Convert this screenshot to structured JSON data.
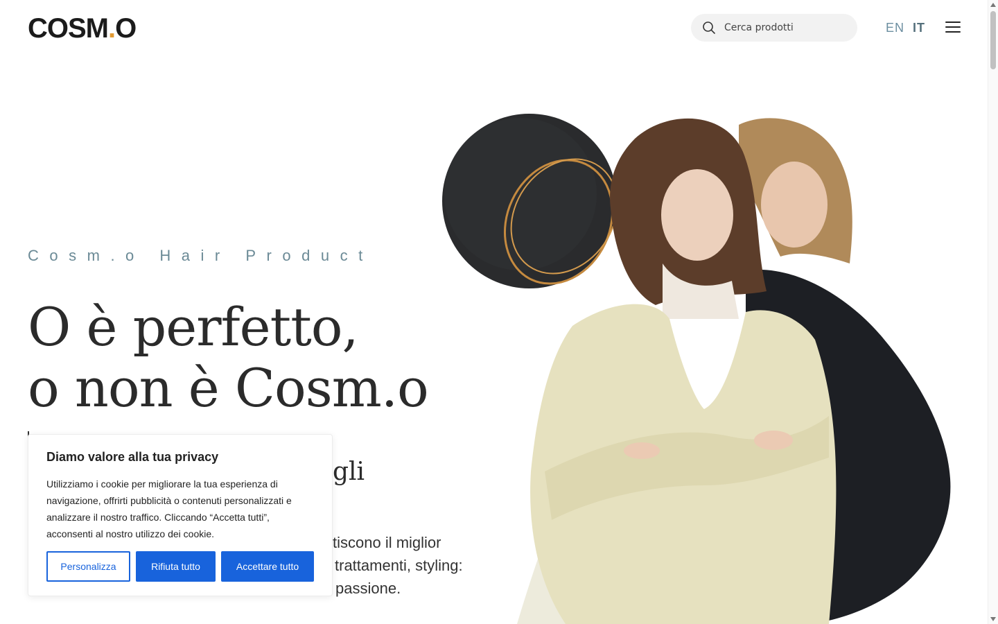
{
  "header": {
    "logo_left": "COSM",
    "logo_dot": ".",
    "logo_right": "O",
    "search_placeholder": "Cerca prodotti",
    "languages": [
      "EN",
      "IT"
    ],
    "active_language": "IT"
  },
  "hero": {
    "eyebrow": "Cosm.o Hair Product",
    "headline_line1": "O è perfetto,",
    "headline_line2": "o non è Cosm.o",
    "sub_visible": "gli",
    "body_line1": "tiscono il miglior",
    "body_line2": "trattamenti, styling:",
    "body_line3": "passione."
  },
  "cookie_banner": {
    "title": "Diamo valore alla tua privacy",
    "text": "Utilizziamo i cookie per migliorare la tua esperienza di navigazione, offrirti pubblicità o contenuti personalizzati e analizzare il nostro traffico. Cliccando “Accetta tutti”, acconsenti al nostro utilizzo dei cookie.",
    "customize_label": "Personalizza",
    "reject_label": "Rifiuta tutto",
    "accept_label": "Accettare tutto"
  },
  "colors": {
    "accent": "#1863dc",
    "logo_dot": "#e29a33",
    "eyebrow": "#6b8a96"
  },
  "icons": {
    "search": "search-icon",
    "menu": "hamburger-menu-icon"
  }
}
